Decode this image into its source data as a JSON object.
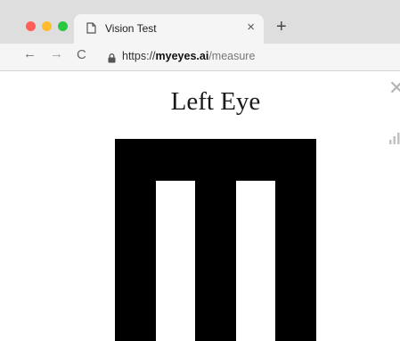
{
  "browser": {
    "tab": {
      "title": "Vision Test",
      "close_label": "×",
      "icon": "page-icon"
    },
    "new_tab_label": "+",
    "nav": {
      "back": "←",
      "forward": "→",
      "reload": "C"
    },
    "address_bar": {
      "scheme": "https://",
      "host": "myeyes.ai",
      "path": "/measure",
      "icon": "lock-icon"
    }
  },
  "page": {
    "title": "Left Eye",
    "close_label": "✕",
    "signal_icon": "signal-bars-icon",
    "optotype": "E-chart-symbol"
  },
  "colors": {
    "tabbar": "#dedede",
    "toolbar": "#f5f5f5",
    "optotype": "#000000",
    "close": "#b5b5b5"
  }
}
